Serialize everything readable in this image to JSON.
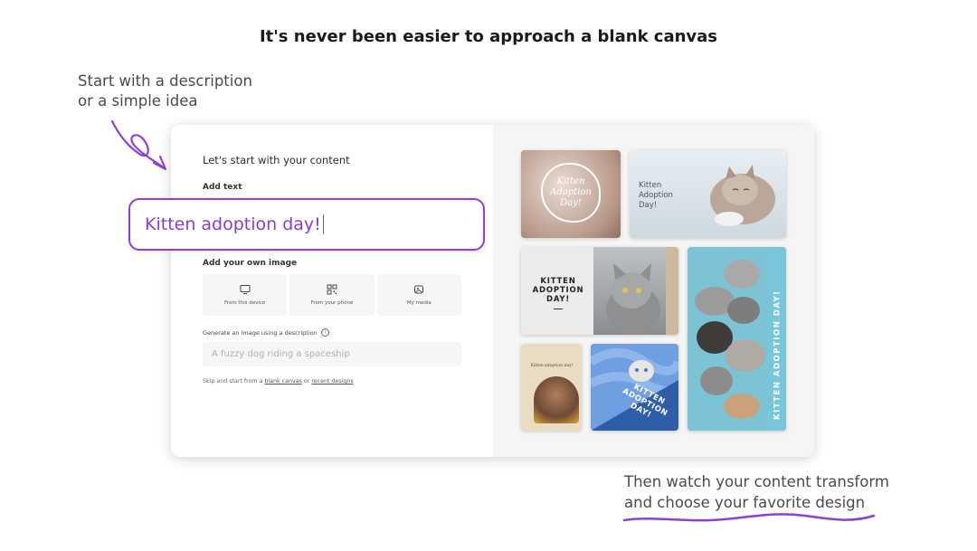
{
  "headline": "It's never been easier to approach a blank canvas",
  "note_left": {
    "line1": "Start with a description",
    "line2": "or a simple idea"
  },
  "note_right": {
    "line1": "Then watch your content transform",
    "line2": "and choose your favorite design"
  },
  "form": {
    "title": "Let's start with your content",
    "add_text_label": "Add text",
    "text_value": "Kitten adoption day!",
    "add_image_label": "Add your own image",
    "image_options": [
      {
        "label": "From this device",
        "icon": "monitor-icon"
      },
      {
        "label": "From your phone",
        "icon": "qr-code-icon"
      },
      {
        "label": "My media",
        "icon": "media-icon"
      }
    ],
    "generate_label": "Generate an image using a description",
    "generate_placeholder": "A fuzzy dog riding a spaceship",
    "skip_prefix": "Skip and start from a",
    "blank_canvas_link": "blank canvas",
    "skip_or": "or",
    "recent_designs_link": "recent designs"
  },
  "designs": {
    "d1_text": "Kitten Adoption Day!",
    "d2_text": "Kitten Adoption Day!",
    "d3_text": "KITTEN ADOPTION DAY!",
    "d4_text": "KITTEN ADOPTION DAY!",
    "d5_text": "Kitten adoption day!",
    "d6_text": "KITTEN ADOPTION DAY!"
  },
  "colors": {
    "accent_purple": "#8f3fd6",
    "panel_gray": "#f5f5f5"
  }
}
